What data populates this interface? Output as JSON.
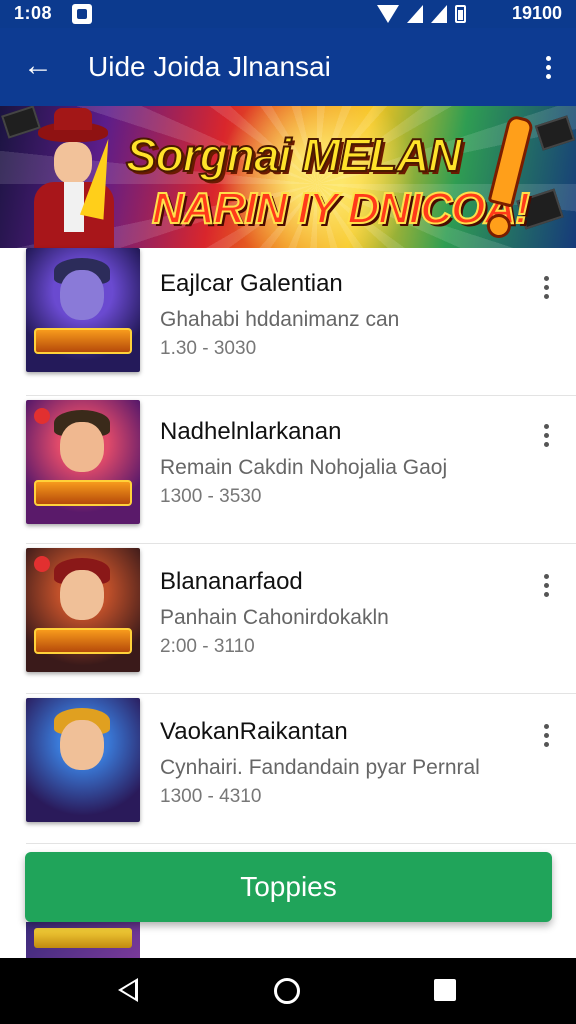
{
  "status_bar": {
    "time": "1:08",
    "right_text": "19100",
    "icons": [
      "notification-icon",
      "wifi-icon",
      "signal-icon",
      "signal-icon",
      "battery-icon"
    ]
  },
  "app_bar": {
    "title": "Uide Joida Jlnansai",
    "back_icon": "arrow-left-icon",
    "menu_icon": "more-vert-icon",
    "background": "#0d3b92"
  },
  "banner": {
    "line1": "Sorgnai MELAN",
    "line2": "NARIN IY DNICOA!"
  },
  "list": {
    "items": [
      {
        "title": "Eajlcar Galentian",
        "subtitle": "Ghahabi hddanimanz can",
        "meta": "1.30 - 3030"
      },
      {
        "title": "Nadhelnlarkanan",
        "subtitle": "Remain Cakdin Nohojalia Gaoj",
        "meta": "1300 - 3530"
      },
      {
        "title": "Blananarfaod",
        "subtitle": "Panhain Cahonirdokakln",
        "meta": "2:00 - 3110"
      },
      {
        "title": "VaokanRaikantan",
        "subtitle": "Cynhairi. Fandandain pyar Pernral",
        "meta": "1300 - 4310"
      }
    ]
  },
  "cta": {
    "label": "Toppies",
    "color": "#20a45a"
  },
  "nav_bar": {
    "icons": [
      "nav-back-icon",
      "nav-home-icon",
      "nav-recents-icon"
    ]
  }
}
